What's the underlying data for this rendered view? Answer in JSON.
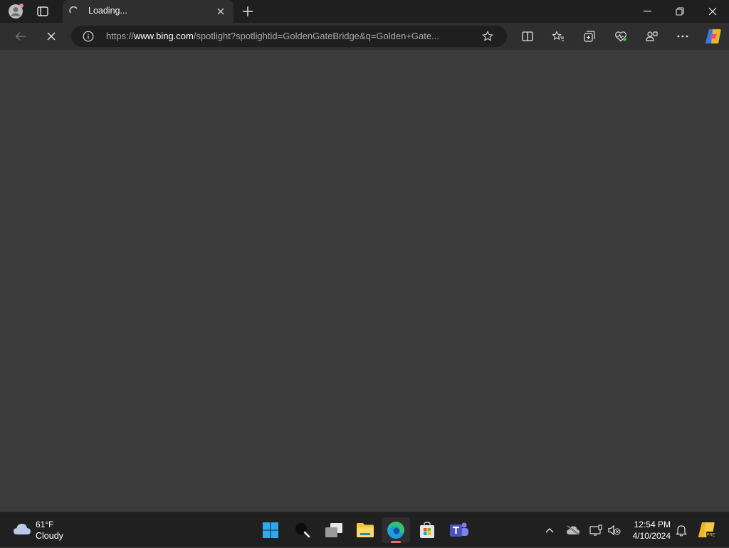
{
  "browser": {
    "tab": {
      "title": "Loading..."
    },
    "address": {
      "url_scheme": "https://",
      "url_host": "www.bing.com",
      "url_rest": "/spotlight?spotlightid=GoldenGateBridge&q=Golden+Gate..."
    }
  },
  "taskbar": {
    "weather": {
      "temp": "61°F",
      "desc": "Cloudy"
    },
    "clock": {
      "time": "12:54 PM",
      "date": "4/10/2024"
    },
    "apps": [
      "start",
      "search",
      "task-view",
      "file-explorer",
      "edge",
      "store",
      "teams"
    ]
  },
  "colors": {
    "accent": "#e8707a",
    "content_bg": "#3b3b3b",
    "titlebar_bg": "#1f1f1f"
  }
}
